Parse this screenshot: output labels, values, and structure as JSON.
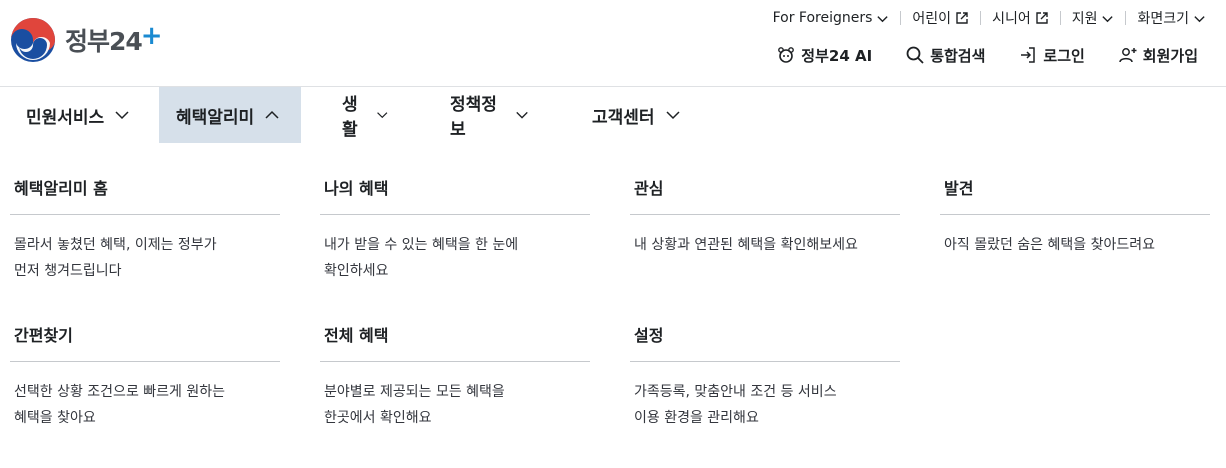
{
  "logo": {
    "text": "정부24",
    "emblem": "taegeuk-emblem-icon"
  },
  "utility_top": [
    {
      "label": "For Foreigners",
      "icon": "chevron-down-icon"
    },
    {
      "label": "어린이",
      "icon": "external-link-icon"
    },
    {
      "label": "시니어",
      "icon": "external-link-icon"
    },
    {
      "label": "지원",
      "icon": "chevron-down-icon"
    },
    {
      "label": "화면크기",
      "icon": "chevron-down-icon"
    }
  ],
  "utility_main": [
    {
      "label": "정부24 AI",
      "icon": "ai-assistant-icon"
    },
    {
      "label": "통합검색",
      "icon": "search-icon"
    },
    {
      "label": "로그인",
      "icon": "login-icon"
    },
    {
      "label": "회원가입",
      "icon": "user-add-icon"
    }
  ],
  "gnb": [
    {
      "label": "민원서비스",
      "expanded": false
    },
    {
      "label": "혜택알리미",
      "expanded": true
    },
    {
      "label": "생활",
      "expanded": false
    },
    {
      "label": "정책정보",
      "expanded": false
    },
    {
      "label": "고객센터",
      "expanded": false
    }
  ],
  "menu": {
    "items": [
      {
        "title": "혜택알리미 홈",
        "desc": "몰라서 놓쳤던 혜택, 이제는 정부가\n먼저 챙겨드립니다"
      },
      {
        "title": "나의 혜택",
        "desc": "내가 받을 수 있는 혜택을 한 눈에\n확인하세요"
      },
      {
        "title": "관심",
        "desc": "내 상황과 연관된 혜택을 확인해보세요"
      },
      {
        "title": "발견",
        "desc": "아직 몰랐던 숨은 혜택을 찾아드려요"
      },
      {
        "title": "간편찾기",
        "desc": "선택한 상황 조건으로 빠르게 원하는\n혜택을 찾아요"
      },
      {
        "title": "전체 혜택",
        "desc": "분야별로 제공되는 모든 혜택을\n한곳에서 확인해요"
      },
      {
        "title": "설정",
        "desc": "가족등록, 맞춤안내 조건 등 서비스\n이용 환경을 관리해요"
      }
    ]
  },
  "colors": {
    "active_tab_bg": "#d6e0ea",
    "text": "#1e2124",
    "divider": "#c6c9cd",
    "logo_red": "#e0453c",
    "logo_blue": "#1a4ea1"
  }
}
